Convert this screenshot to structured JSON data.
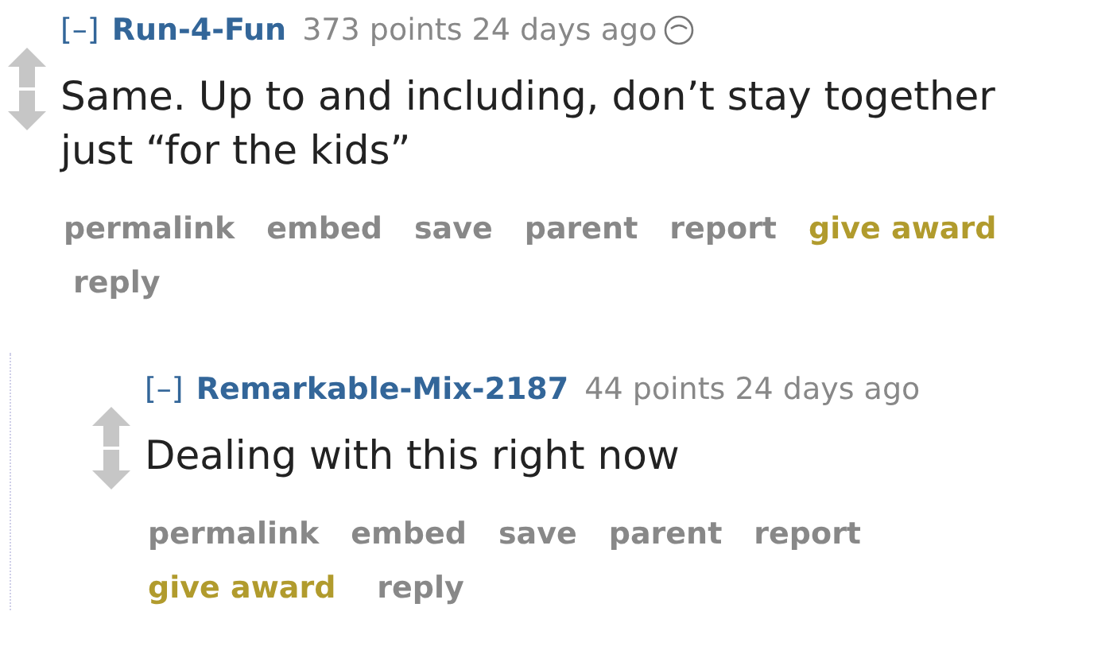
{
  "comments": [
    {
      "collapse": "[–]",
      "author": "Run-4-Fun",
      "points": "373 points",
      "time": "24 days ago",
      "flair": true,
      "body": "Same. Up to and including, don’t stay together just “for the kids”",
      "buttons": [
        {
          "label": "permalink",
          "kind": "normal"
        },
        {
          "label": "embed",
          "kind": "normal"
        },
        {
          "label": "save",
          "kind": "normal"
        },
        {
          "label": "parent",
          "kind": "normal"
        },
        {
          "label": "report",
          "kind": "normal"
        },
        {
          "label": "give award",
          "kind": "award"
        },
        {
          "label": "reply",
          "kind": "normal"
        }
      ],
      "children": [
        {
          "collapse": "[–]",
          "author": "Remarkable-Mix-2187",
          "points": "44 points",
          "time": "24 days ago",
          "body": "Dealing with this right now",
          "buttons": [
            {
              "label": "permalink",
              "kind": "normal"
            },
            {
              "label": "embed",
              "kind": "normal"
            },
            {
              "label": "save",
              "kind": "normal"
            },
            {
              "label": "parent",
              "kind": "normal"
            },
            {
              "label": "report",
              "kind": "normal"
            },
            {
              "label": "give award",
              "kind": "award"
            },
            {
              "label": "reply",
              "kind": "normal"
            }
          ]
        }
      ]
    }
  ]
}
